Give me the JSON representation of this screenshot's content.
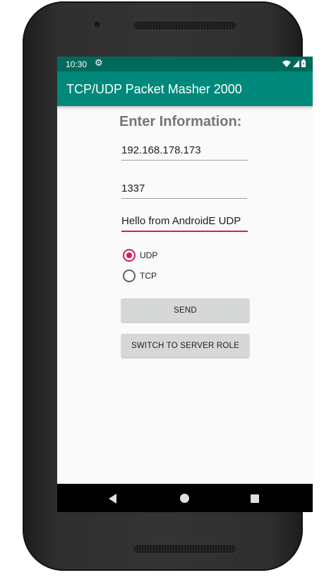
{
  "status_bar": {
    "time": "10:30",
    "gear_icon": "settings-gear",
    "wifi_icon": "wifi-full",
    "signal_icon": "cell-signal",
    "battery_icon": "battery"
  },
  "app_bar": {
    "title": "TCP/UDP Packet Masher 2000"
  },
  "form": {
    "heading": "Enter Information:",
    "ip_value": "192.168.178.173",
    "port_value": "1337",
    "message_value": "Hello from AndroidE UDP",
    "protocol_options": [
      {
        "label": "UDP",
        "checked": true
      },
      {
        "label": "TCP",
        "checked": false
      }
    ],
    "send_label": "SEND",
    "switch_label": "SWITCH TO SERVER ROLE"
  },
  "nav_bar": {
    "back_icon": "back-triangle",
    "home_icon": "home-circle",
    "recents_icon": "recents-square"
  },
  "colors": {
    "primary": "#00897b",
    "primary_dark": "#00695c",
    "accent": "#d81b60"
  }
}
